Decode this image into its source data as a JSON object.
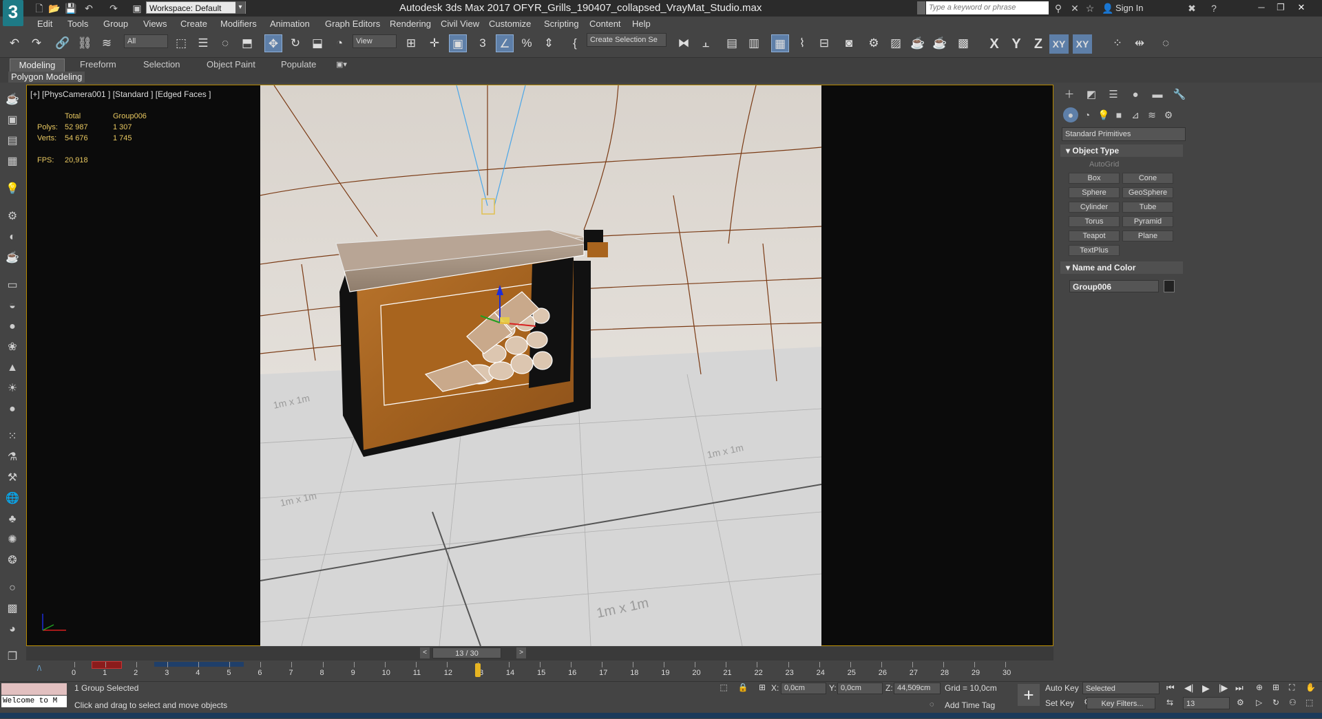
{
  "title_bar": {
    "workspace": "Workspace: Default",
    "app_title": "Autodesk 3ds Max 2017     OFYR_Grills_190407_collapsed_VrayMat_Studio.max",
    "search_placeholder": "Type a keyword or phrase",
    "sign_in": "Sign In"
  },
  "menu": [
    "Edit",
    "Tools",
    "Group",
    "Views",
    "Create",
    "Modifiers",
    "Animation",
    "Graph Editors",
    "Rendering",
    "Civil View",
    "Customize",
    "Scripting",
    "Content",
    "Help"
  ],
  "toolbar": {
    "selection_filter": "All",
    "reference_coord": "View",
    "named_selection": "Create Selection Se",
    "axis_x": "X",
    "axis_y": "Y",
    "axis_z": "Z",
    "axis_xy": "XY",
    "axis_xy2": "XY"
  },
  "ribbon": {
    "tabs": [
      "Modeling",
      "Freeform",
      "Selection",
      "Object Paint",
      "Populate"
    ],
    "panel_label": "Polygon Modeling"
  },
  "viewport": {
    "label": "[+] [PhysCamera001 ] [Standard ] [Edged Faces ]",
    "stats": {
      "col_total": "Total",
      "col_group": "Group006",
      "polys_label": "Polys:",
      "polys_total": "52 987",
      "polys_group": "1 307",
      "verts_label": "Verts:",
      "verts_total": "54 676",
      "verts_group": "1 745",
      "fps_label": "FPS:",
      "fps_value": "20,918"
    },
    "grid_labels": [
      "1m x 1m",
      "1m x 1m",
      "1m x 1m",
      "1m x 1m"
    ]
  },
  "command_panel": {
    "category": "Standard Primitives",
    "object_type_title": "Object Type",
    "autogrid": "AutoGrid",
    "buttons": [
      "Box",
      "Cone",
      "Sphere",
      "GeoSphere",
      "Cylinder",
      "Tube",
      "Torus",
      "Pyramid",
      "Teapot",
      "Plane",
      "TextPlus"
    ],
    "name_color_title": "Name and Color",
    "object_name": "Group006",
    "object_color": "#222222"
  },
  "timeline": {
    "slider_label": "13 / 30",
    "ticks": [
      "0",
      "1",
      "2",
      "3",
      "4",
      "5",
      "6",
      "7",
      "8",
      "9",
      "10",
      "11",
      "12",
      "13",
      "14",
      "15",
      "16",
      "17",
      "18",
      "19",
      "20",
      "21",
      "22",
      "23",
      "24",
      "25",
      "26",
      "27",
      "28",
      "29",
      "30"
    ],
    "current_frame": 13,
    "total_frames": 30
  },
  "status": {
    "listener_text": "Welcome to M",
    "selection": "1 Group Selected",
    "prompt": "Click and drag to select and move objects",
    "x_label": "X:",
    "x_value": "0,0cm",
    "y_label": "Y:",
    "y_value": "0,0cm",
    "z_label": "Z:",
    "z_value": "44,509cm",
    "grid": "Grid = 10,0cm",
    "add_time_tag": "Add Time Tag",
    "auto_key": "Auto Key",
    "set_key": "Set Key",
    "key_mode": "Selected",
    "key_filters": "Key Filters...",
    "frame": "13"
  },
  "colors": {
    "viewport_border": "#b88b00",
    "active_tool": "#5e7fa8",
    "wood": "#a8641e",
    "floor": "#d9d9d9"
  }
}
